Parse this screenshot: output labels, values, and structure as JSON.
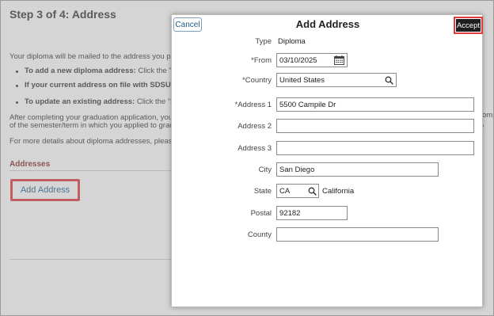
{
  "background": {
    "step_title": "Step 3 of 4: Address",
    "intro_text": "Your diploma will be mailed to the address you prov",
    "bullets": [
      {
        "bold": "To add a new diploma address:",
        "rest": " Click the \"+\""
      },
      {
        "bold": "If your current address on file with SDSU is",
        "rest": ""
      },
      {
        "bold": "To update an existing address:",
        "rest": " Click the \">\""
      }
    ],
    "para_line1": "After completing your graduation application, you ca",
    "para_line2": "of the semester/term in which you applied to gradua",
    "details_text": "For more details about diploma addresses, please v",
    "right_edge_text_1": "omp",
    "right_edge_text_2": ",",
    "addresses_heading": "Addresses",
    "add_address_label": "Add Address"
  },
  "modal": {
    "title": "Add Address",
    "cancel_label": "Cancel",
    "accept_label": "Accept",
    "fields": {
      "type": {
        "label": "Type",
        "value": "Diploma"
      },
      "from": {
        "label": "*From",
        "value": "03/10/2025"
      },
      "country": {
        "label": "*Country",
        "value": "United States"
      },
      "address1": {
        "label": "*Address 1",
        "value": "5500 Campile Dr"
      },
      "address2": {
        "label": "Address 2",
        "value": ""
      },
      "address3": {
        "label": "Address 3",
        "value": ""
      },
      "city": {
        "label": "City",
        "value": "San Diego"
      },
      "state": {
        "label": "State",
        "value": "CA",
        "description": "California"
      },
      "postal": {
        "label": "Postal",
        "value": "92182"
      },
      "county": {
        "label": "County",
        "value": ""
      }
    }
  },
  "colors": {
    "accent_red": "#e03a3e",
    "link_blue": "#1f5d86",
    "heading_maroon": "#8b2a25"
  },
  "icons": {
    "calendar": "calendar-icon",
    "search": "search-icon"
  }
}
